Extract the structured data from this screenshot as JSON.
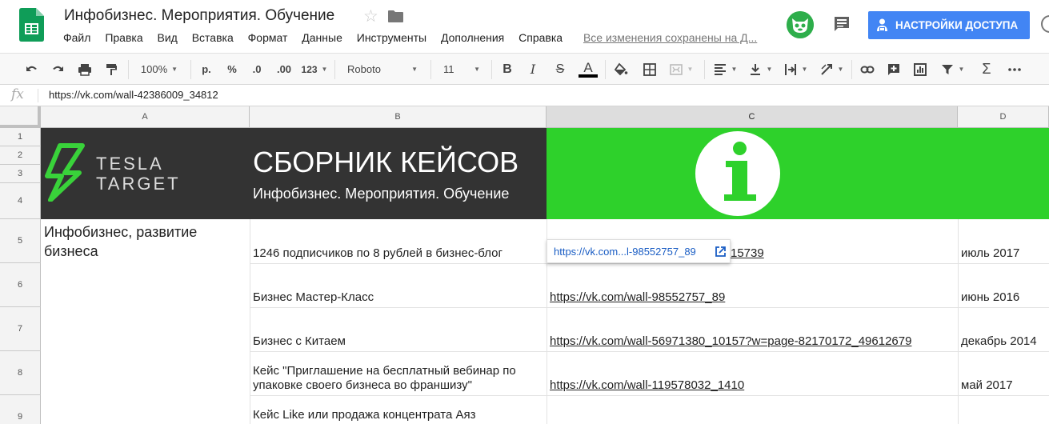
{
  "doc": {
    "title": "Инфобизнес. Мероприятия. Обучение",
    "saved_status": "Все изменения сохранены на Д..."
  },
  "menu": [
    "Файл",
    "Правка",
    "Вид",
    "Вставка",
    "Формат",
    "Данные",
    "Инструменты",
    "Дополнения",
    "Справка"
  ],
  "share_button": "НАСТРОЙКИ ДОСТУПА",
  "toolbar": {
    "zoom": "100%",
    "currency": "р.",
    "percent": "%",
    "dec_decrease": ".0",
    "dec_increase": ".00",
    "more_formats": "123",
    "font": "Roboto",
    "font_size": "11",
    "bold": "B",
    "italic": "I",
    "strike": "S",
    "text_color": "A"
  },
  "formula_bar": {
    "fx": "fx",
    "value": "https://vk.com/wall-42386009_34812"
  },
  "columns": [
    "A",
    "B",
    "C",
    "D"
  ],
  "rows": [
    "1",
    "2",
    "3",
    "4",
    "5",
    "6",
    "7",
    "8",
    "9"
  ],
  "banner": {
    "logo_line1": "TESLA",
    "logo_line2": "TARGET",
    "title": "СБОРНИК КЕЙСОВ",
    "subtitle": "Инфобизнес. Мероприятия. Обучение",
    "info_glyph": "i"
  },
  "category": "Инфобизнес, развитие бизнеса",
  "cases": [
    {
      "name": "1246 подписчиков по 8 рублей в бизнес-блог",
      "link": "15739",
      "date": "июль 2017"
    },
    {
      "name": "Бизнес Мастер-Класс",
      "link": "https://vk.com/wall-98552757_89",
      "date": "июнь 2016"
    },
    {
      "name": "Бизнес с Китаем",
      "link": "https://vk.com/wall-56971380_10157?w=page-82170172_49612679",
      "date": "декабрь 2014"
    },
    {
      "name_line1": "Кейс \"Приглашение на бесплатный вебинар по",
      "name_line2": "упаковке своего бизнеса во франшизу\"",
      "link": "https://vk.com/wall-119578032_1410",
      "date": "май 2017"
    },
    {
      "name": "Кейс Like или продажа концентрата Аяз",
      "link": "",
      "date": ""
    }
  ],
  "link_preview": "https://vk.com...l-98552757_89",
  "colors": {
    "banner_dark": "#333333",
    "banner_green": "#2ed12b",
    "share_blue": "#4285f4",
    "sheets_green": "#0f9d58"
  }
}
